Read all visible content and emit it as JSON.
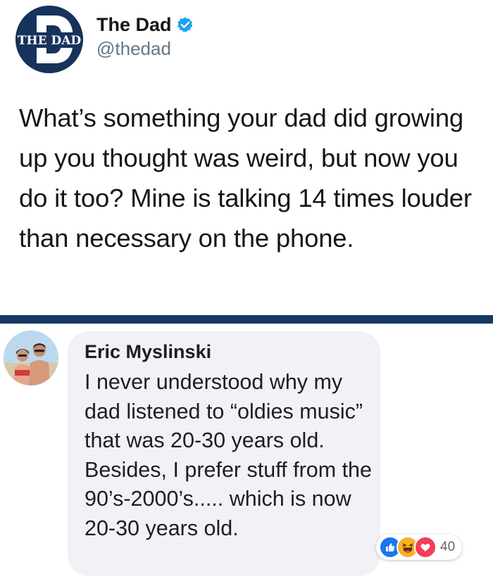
{
  "tweet": {
    "author_name": "The Dad",
    "author_handle": "@thedad",
    "avatar_text": "THE DAD",
    "verified": true,
    "text": "What’s something your dad did growing up you thought was weird, but now you do it too? Mine is talking 14 times louder than necessary on the phone."
  },
  "comment": {
    "author_name": "Eric Myslinski",
    "text": "I never understood why my dad listened to “oldies music” that was 20-30 years old.  Besides, I prefer stuff from the 90’s-2000’s..... which is now 20-30 years old.",
    "reactions": {
      "icons": [
        "like-icon",
        "haha-icon",
        "love-icon"
      ],
      "count": "40"
    }
  },
  "colors": {
    "brand_navy": "#17335c",
    "divider": "#153963",
    "verified_blue": "#1da1f2",
    "bubble_bg": "#f0f2f5",
    "like_blue": "#1877f2",
    "haha_yellow": "#f7b125",
    "love_red": "#f33e58"
  }
}
